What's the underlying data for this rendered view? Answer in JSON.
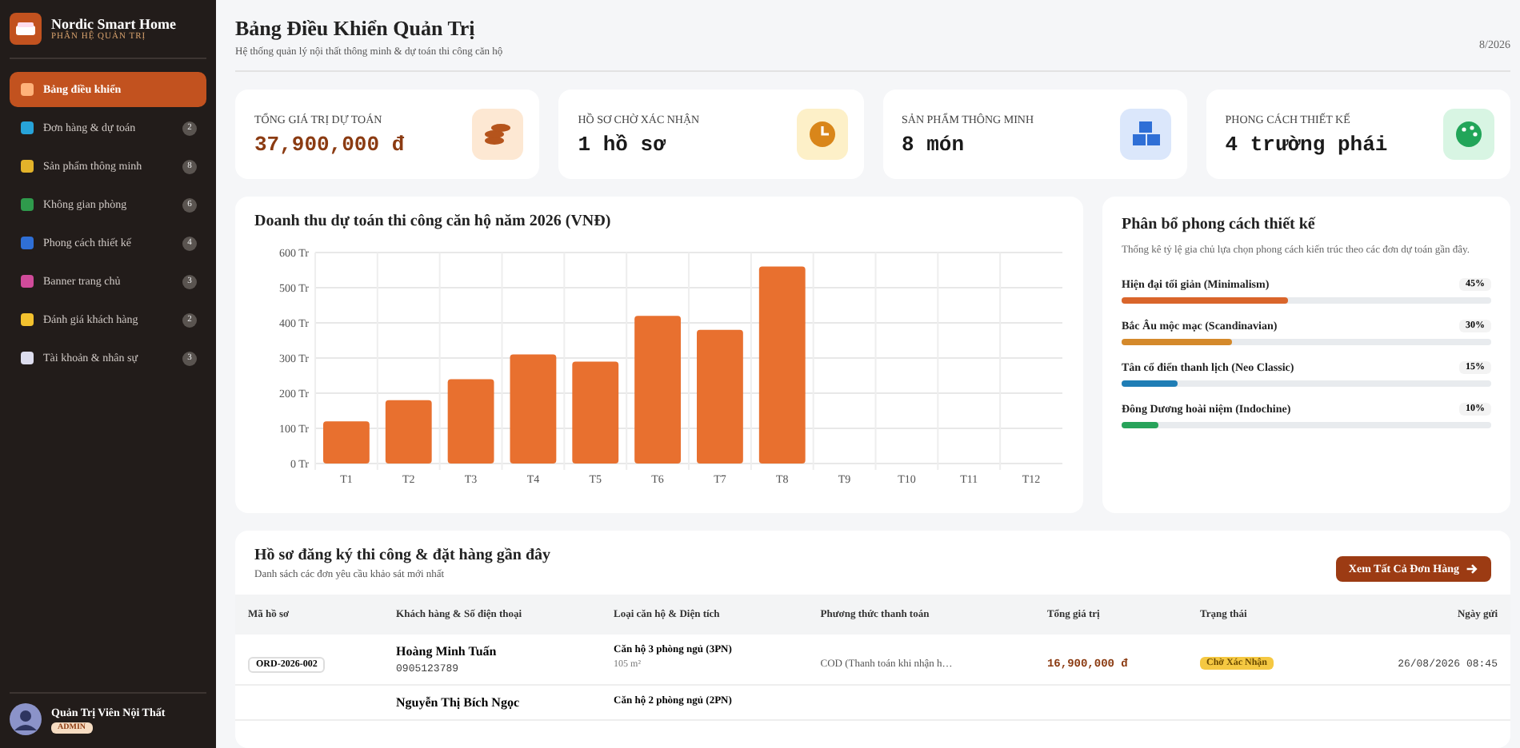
{
  "sidebar": {
    "brand": "Nordic Smart Home",
    "subtitle": "PHÂN HỆ QUẢN TRỊ",
    "items": [
      {
        "label": "Bảng điều khiển",
        "selected": true
      },
      {
        "label": "Đơn hàng & dự toán",
        "badge": "2",
        "selected": false
      },
      {
        "label": "Sản phẩm thông minh",
        "badge": "8",
        "selected": false
      },
      {
        "label": "Không gian phòng",
        "badge": "6",
        "selected": false
      },
      {
        "label": "Phong cách thiết kế",
        "badge": "4",
        "selected": false
      },
      {
        "label": "Banner trang chủ",
        "badge": "3",
        "selected": false
      },
      {
        "label": "Đánh giá khách hàng",
        "badge": "2",
        "selected": false
      },
      {
        "label": "Tài khoản & nhân sự",
        "badge": "3",
        "selected": false
      }
    ],
    "user": {
      "name": "Quản Trị Viên Nội Thất",
      "role": "ADMIN"
    }
  },
  "header": {
    "title": "Bảng Điều Khiển Quản Trị",
    "subtitle": "Hệ thống quản lý nội thất thông minh & dự toán thi công căn hộ",
    "date": "8/2026"
  },
  "stats": [
    {
      "label": "TỔNG GIÁ TRỊ DỰ TOÁN",
      "value": "37,900,000 đ",
      "accent": true
    },
    {
      "label": "HỒ SƠ CHỜ XÁC NHẬN",
      "value": "1 hồ sơ",
      "accent": false
    },
    {
      "label": "SẢN PHẨM THÔNG MINH",
      "value": "8 món",
      "accent": false
    },
    {
      "label": "PHONG CÁCH THIẾT KẾ",
      "value": "4 trường phái",
      "accent": false
    }
  ],
  "revenue": {
    "title": "Doanh thu dự toán thi công căn hộ năm 2026 (VNĐ)",
    "chart_data": {
      "type": "bar",
      "categories": [
        "T1",
        "T2",
        "T3",
        "T4",
        "T5",
        "T6",
        "T7",
        "T8",
        "T9",
        "T10",
        "T11",
        "T12"
      ],
      "grid": true,
      "series": [
        {
          "color": "#e8702f",
          "values": [
            120,
            180,
            240,
            310,
            290,
            420,
            380,
            560,
            null,
            null,
            null,
            null
          ]
        }
      ],
      "ylim": [
        0,
        600
      ],
      "yticks": [
        {
          "value": 0,
          "label": "0 Tr"
        },
        {
          "value": 100,
          "label": "100 Tr"
        },
        {
          "value": 200,
          "label": "200 Tr"
        },
        {
          "value": 300,
          "label": "300 Tr"
        },
        {
          "value": 400,
          "label": "400 Tr"
        },
        {
          "value": 500,
          "label": "500 Tr"
        },
        {
          "value": 600,
          "label": "600 Tr"
        }
      ]
    }
  },
  "styles": {
    "title": "Phân bổ phong cách thiết kế",
    "description": "Thống kê tỷ lệ gia chủ lựa chọn phong cách kiến trúc theo các đơn dự toán gần đây.",
    "items": [
      {
        "name": "Hiện đại tối giản (Minimalism)",
        "percent": "45%",
        "level": 0.45,
        "color": "#d9652b"
      },
      {
        "name": "Bắc Âu mộc mạc (Scandinavian)",
        "percent": "30%",
        "level": 0.3,
        "color": "#d4892b"
      },
      {
        "name": "Tân cổ điển thanh lịch (Neo Classic)",
        "percent": "15%",
        "level": 0.15,
        "color": "#1f7db5"
      },
      {
        "name": "Đông Dương hoài niệm (Indochine)",
        "percent": "10%",
        "level": 0.1,
        "color": "#27a35a"
      }
    ]
  },
  "orders": {
    "title": "Hồ sơ đăng ký thi công & đặt hàng gần đây",
    "subtitle": "Danh sách các đơn yêu cầu khảo sát mới nhất",
    "button": "Xem Tất Cả Đơn Hàng",
    "columns": [
      "Mã hồ sơ",
      "Khách hàng & Số điện thoại",
      "Loại căn hộ & Diện tích",
      "Phương thức thanh toán",
      "Tổng giá trị",
      "Trạng thái",
      "Ngày gửi"
    ],
    "rows": [
      {
        "code": "ORD-2026-002",
        "customer": "Hoàng Minh Tuấn",
        "phone": "0905123789",
        "apartment": "Căn hộ 3 phòng ngủ (3PN)",
        "area": "105 m²",
        "payment": "COD (Thanh toán khi nhận h…",
        "total": "16,900,000 đ",
        "status": "Chờ Xác Nhận",
        "date": "26/08/2026 08:45"
      },
      {
        "customer": "Nguyễn Thị Bích Ngọc",
        "apartment": "Căn hộ 2 phòng ngủ (2PN)"
      }
    ]
  }
}
